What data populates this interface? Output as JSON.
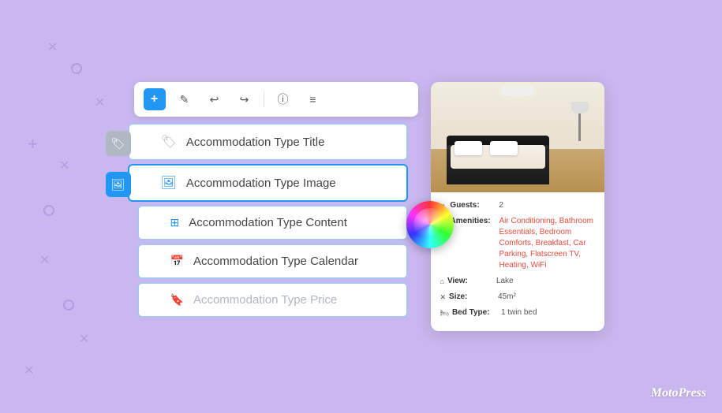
{
  "page": {
    "background_color": "#c9b8f0",
    "brand": "MotoPress"
  },
  "toolbar": {
    "buttons": [
      {
        "id": "add",
        "icon": "+",
        "label": "Add",
        "active": true
      },
      {
        "id": "edit",
        "icon": "✏",
        "label": "Edit",
        "active": false
      },
      {
        "id": "undo",
        "icon": "↩",
        "label": "Undo",
        "active": false
      },
      {
        "id": "redo",
        "icon": "↪",
        "label": "Redo",
        "active": false
      },
      {
        "id": "info",
        "icon": "ℹ",
        "label": "Info",
        "active": false
      },
      {
        "id": "menu",
        "icon": "≡",
        "label": "Menu",
        "active": false
      }
    ]
  },
  "widgets": [
    {
      "id": "title",
      "label": "Accommodation Type Title",
      "icon_type": "gray",
      "left_icon": "gray",
      "active": false
    },
    {
      "id": "image",
      "label": "Accommodation Type Image",
      "icon_type": "blue",
      "left_icon": "blue",
      "active": true
    },
    {
      "id": "content",
      "label": "Accommodation Type Content",
      "icon_type": "blue",
      "left_icon": "none",
      "active": false
    },
    {
      "id": "calendar",
      "label": "Accommodation Type Calendar",
      "icon_type": "blue",
      "left_icon": "none",
      "active": false
    },
    {
      "id": "price",
      "label": "Accommodation Type Price",
      "icon_type": "gray",
      "left_icon": "none",
      "active": false
    }
  ],
  "card": {
    "details": [
      {
        "icon": "👤",
        "label": "Guests:",
        "value": "2",
        "colored": false
      },
      {
        "icon": "🔧",
        "label": "Amenities:",
        "value": "Air Conditioning, Bathroom Essentials, Bedroom Comforts, Breakfast, Car Parking, Flatscreen TV, Heating, WiFi",
        "colored": true
      },
      {
        "icon": "🏔",
        "label": "View:",
        "value": "Lake",
        "colored": false
      },
      {
        "icon": "📐",
        "label": "Size:",
        "value": "45m²",
        "colored": false
      },
      {
        "icon": "🛏",
        "label": "Bed Type:",
        "value": "1 twin bed",
        "colored": false
      }
    ]
  }
}
